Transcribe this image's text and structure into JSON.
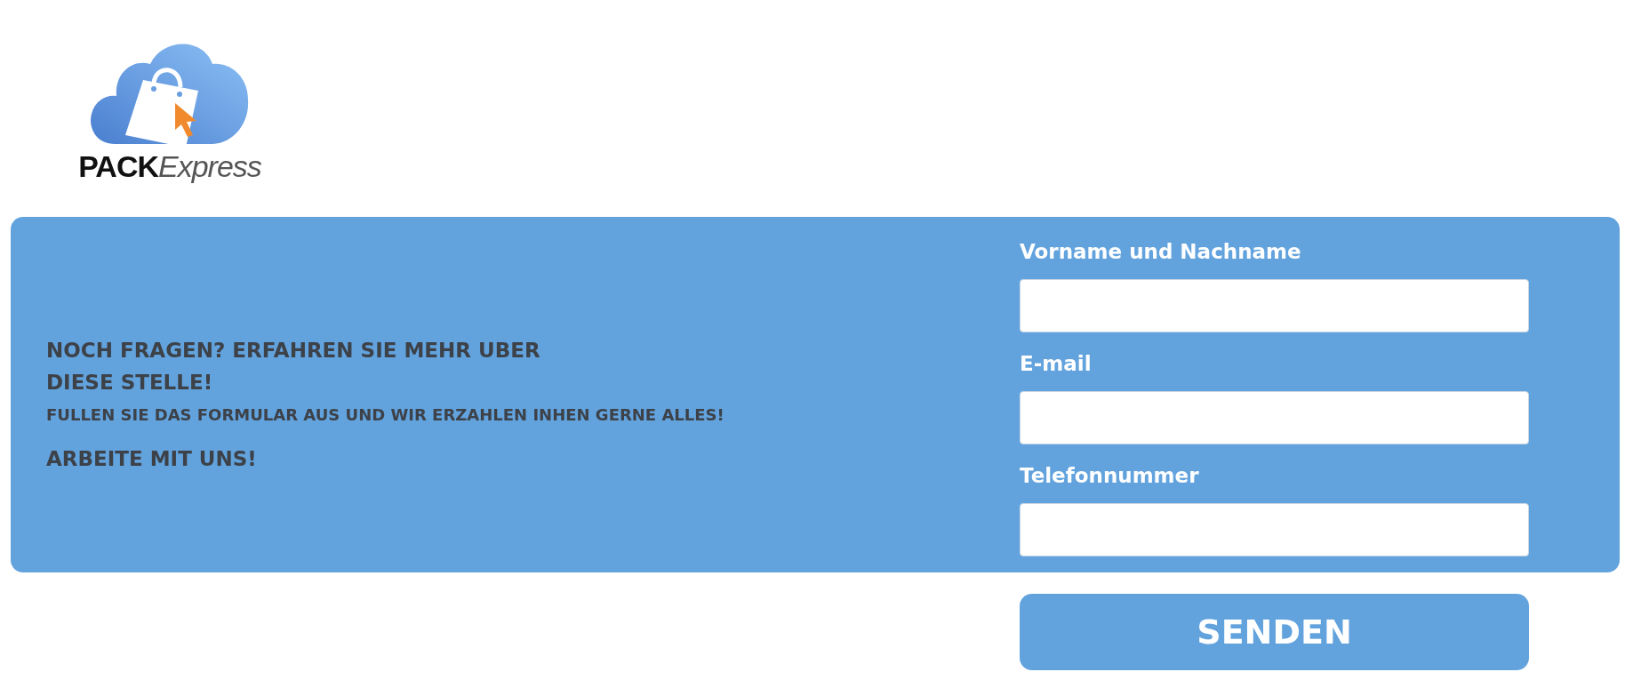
{
  "logo": {
    "part_1": "PACK",
    "part_2": "Express"
  },
  "intro": {
    "heading": "NOCH FRAGEN? ERFAHREN SIE MEHR UBER DIESE STELLE!",
    "text": "FULLEN SIE DAS FORMULAR AUS UND WIR ERZAHLEN INHEN GERNE ALLES!",
    "call_to_action": "ARBEITE MIT UNS!"
  },
  "form": {
    "fields": [
      {
        "label": "Vorname und Nachname"
      },
      {
        "label": "E-mail"
      },
      {
        "label": "Telefonnummer"
      }
    ],
    "submit": "SENDEN"
  }
}
